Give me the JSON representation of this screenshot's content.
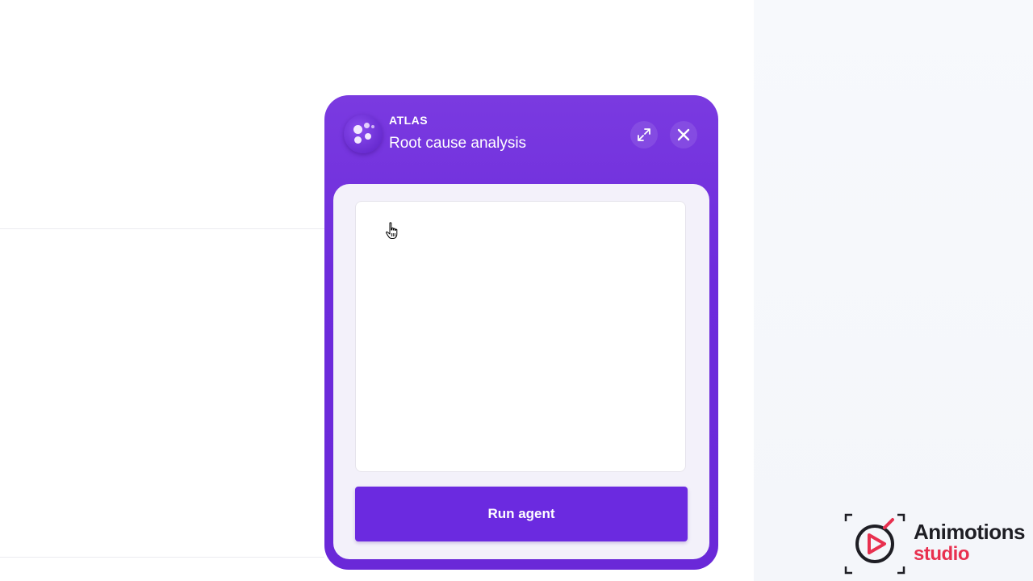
{
  "panel": {
    "app_name": "ATLAS",
    "title": "Root cause analysis",
    "textarea_value": "",
    "run_button_label": "Run agent",
    "icons": {
      "logo": "atlas-logo-icon",
      "expand": "expand-icon",
      "close": "close-icon"
    }
  },
  "watermark": {
    "line1": "Animotions",
    "line2": "studio"
  },
  "colors": {
    "accent": "#6b2ae0",
    "panel_bg": "#7a3ae0",
    "body_bg": "#f3f1fa",
    "watermark_red": "#e8304f"
  }
}
